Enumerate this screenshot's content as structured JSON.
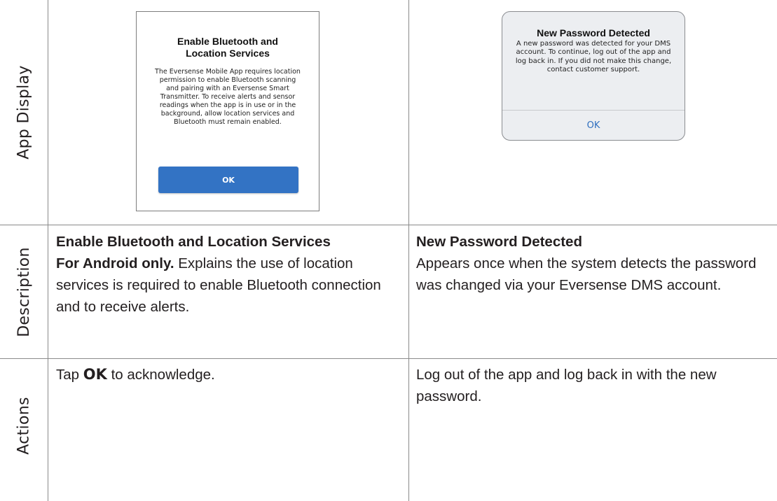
{
  "rows": {
    "app_display": "App Display",
    "description": "Description",
    "actions": "Actions"
  },
  "android_dialog": {
    "title": "Enable Bluetooth and Location Services",
    "body": "The Eversense Mobile App requires location permission to enable Bluetooth scanning and pairing with an Eversense Smart Transmitter. To receive alerts and sensor readings when the app is in use or in the background, allow location services and Bluetooth must remain enabled.",
    "ok_label": "OK"
  },
  "ios_dialog": {
    "title": "New Password Detected",
    "body": "A new password was detected for your DMS account. To continue, log out of the app and log back in. If you did not make this change, contact customer support.",
    "ok_label": "OK"
  },
  "description": {
    "left": {
      "heading": "Enable Bluetooth and Location Services",
      "lead": "For Android only.",
      "text": " Explains the use of location services is required to enable Bluetooth connection and to receive alerts."
    },
    "right": {
      "heading": "New Password Detected",
      "text": "Appears once when the system detects the password was changed via your Eversense DMS account."
    }
  },
  "actions": {
    "left": {
      "prefix": "Tap ",
      "ok": "OK",
      "suffix": " to acknowledge."
    },
    "right": {
      "text": "Log out of the app and log back in with the new password."
    }
  }
}
